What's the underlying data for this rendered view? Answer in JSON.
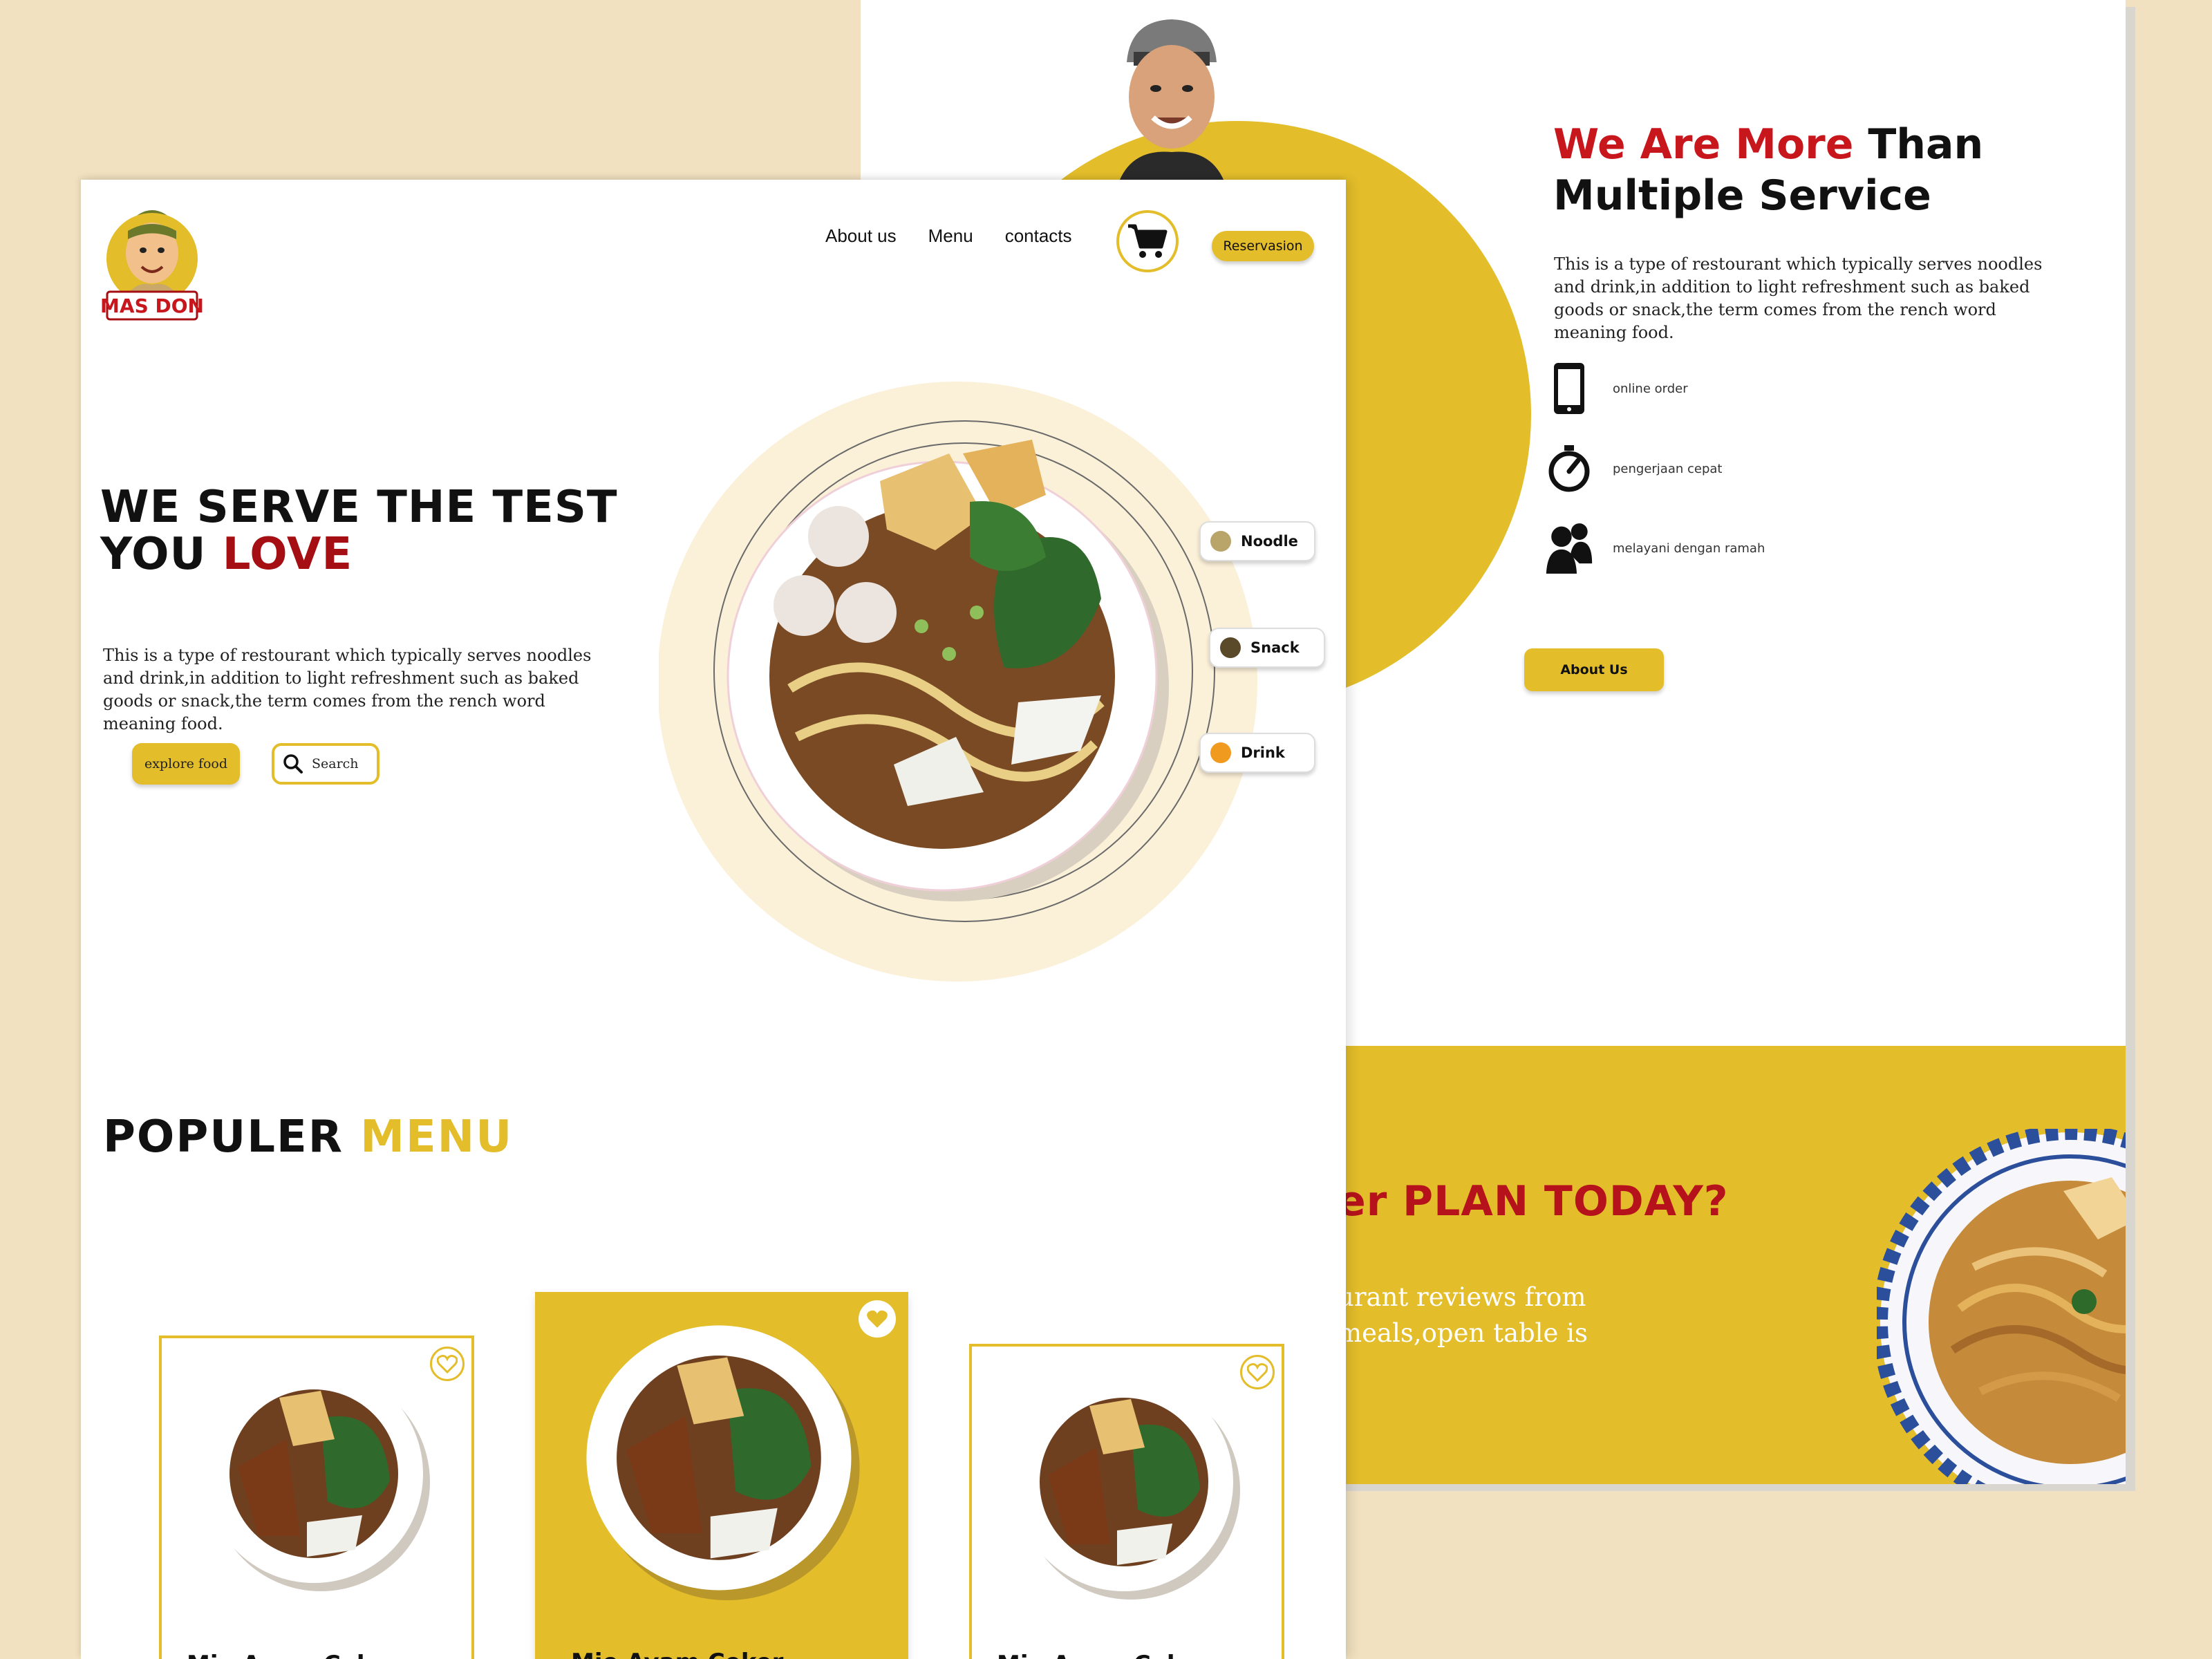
{
  "colors": {
    "accent": "#e3bd2a",
    "red": "#c8161d",
    "dark_red": "#a50e12",
    "cream": "#f1e1c0",
    "plate_ring": "#fbf0d8"
  },
  "brand": {
    "logo_alt": "MAS DON",
    "logo_text": "MAS DON"
  },
  "nav": {
    "items": [
      "About us",
      "Menu",
      "contacts"
    ],
    "cart_icon": "cart-icon",
    "reservation_label": "Reservasion"
  },
  "hero": {
    "title_line1": "WE SERVE THE TEST",
    "title_line2_prefix": "YOU ",
    "title_line2_highlight": "LOVE",
    "description": "This is a type of restourant which typically serves noodles and drink,in addition to light refreshment such as baked goods or snack,the term comes from the rench word meaning food.",
    "explore_label": "explore food",
    "search_placeholder": "Search",
    "categories": [
      "Noodle",
      "Snack",
      "Drink"
    ]
  },
  "popular": {
    "title_prefix": "POPULER ",
    "title_highlight": "MENU",
    "cards": [
      {
        "name": "Mie Ayam Ceker",
        "favorited": false
      },
      {
        "name": "Mie Ayam Ceker",
        "favorited": true
      },
      {
        "name": "Mie Ayam Ceker",
        "favorited": false
      }
    ]
  },
  "about": {
    "title_red": "We Are More",
    "title_rest": " Than",
    "title_line2": "Multiple Service",
    "description": "This is a type of restourant which typically serves noodles and drink,in addition to light refreshment such as baked goods or snack,the term comes from the rench word meaning food.",
    "features": [
      {
        "icon": "phone-icon",
        "label": "online order"
      },
      {
        "icon": "timer-icon",
        "label": "pengerjaan cepat"
      },
      {
        "icon": "people-icon",
        "label": "melayani dengan ramah"
      }
    ],
    "button_label": "About Us"
  },
  "banner": {
    "title": "er PLAN TODAY?",
    "text_line1": "urant reviews from",
    "text_line2": "meals,open table is"
  }
}
